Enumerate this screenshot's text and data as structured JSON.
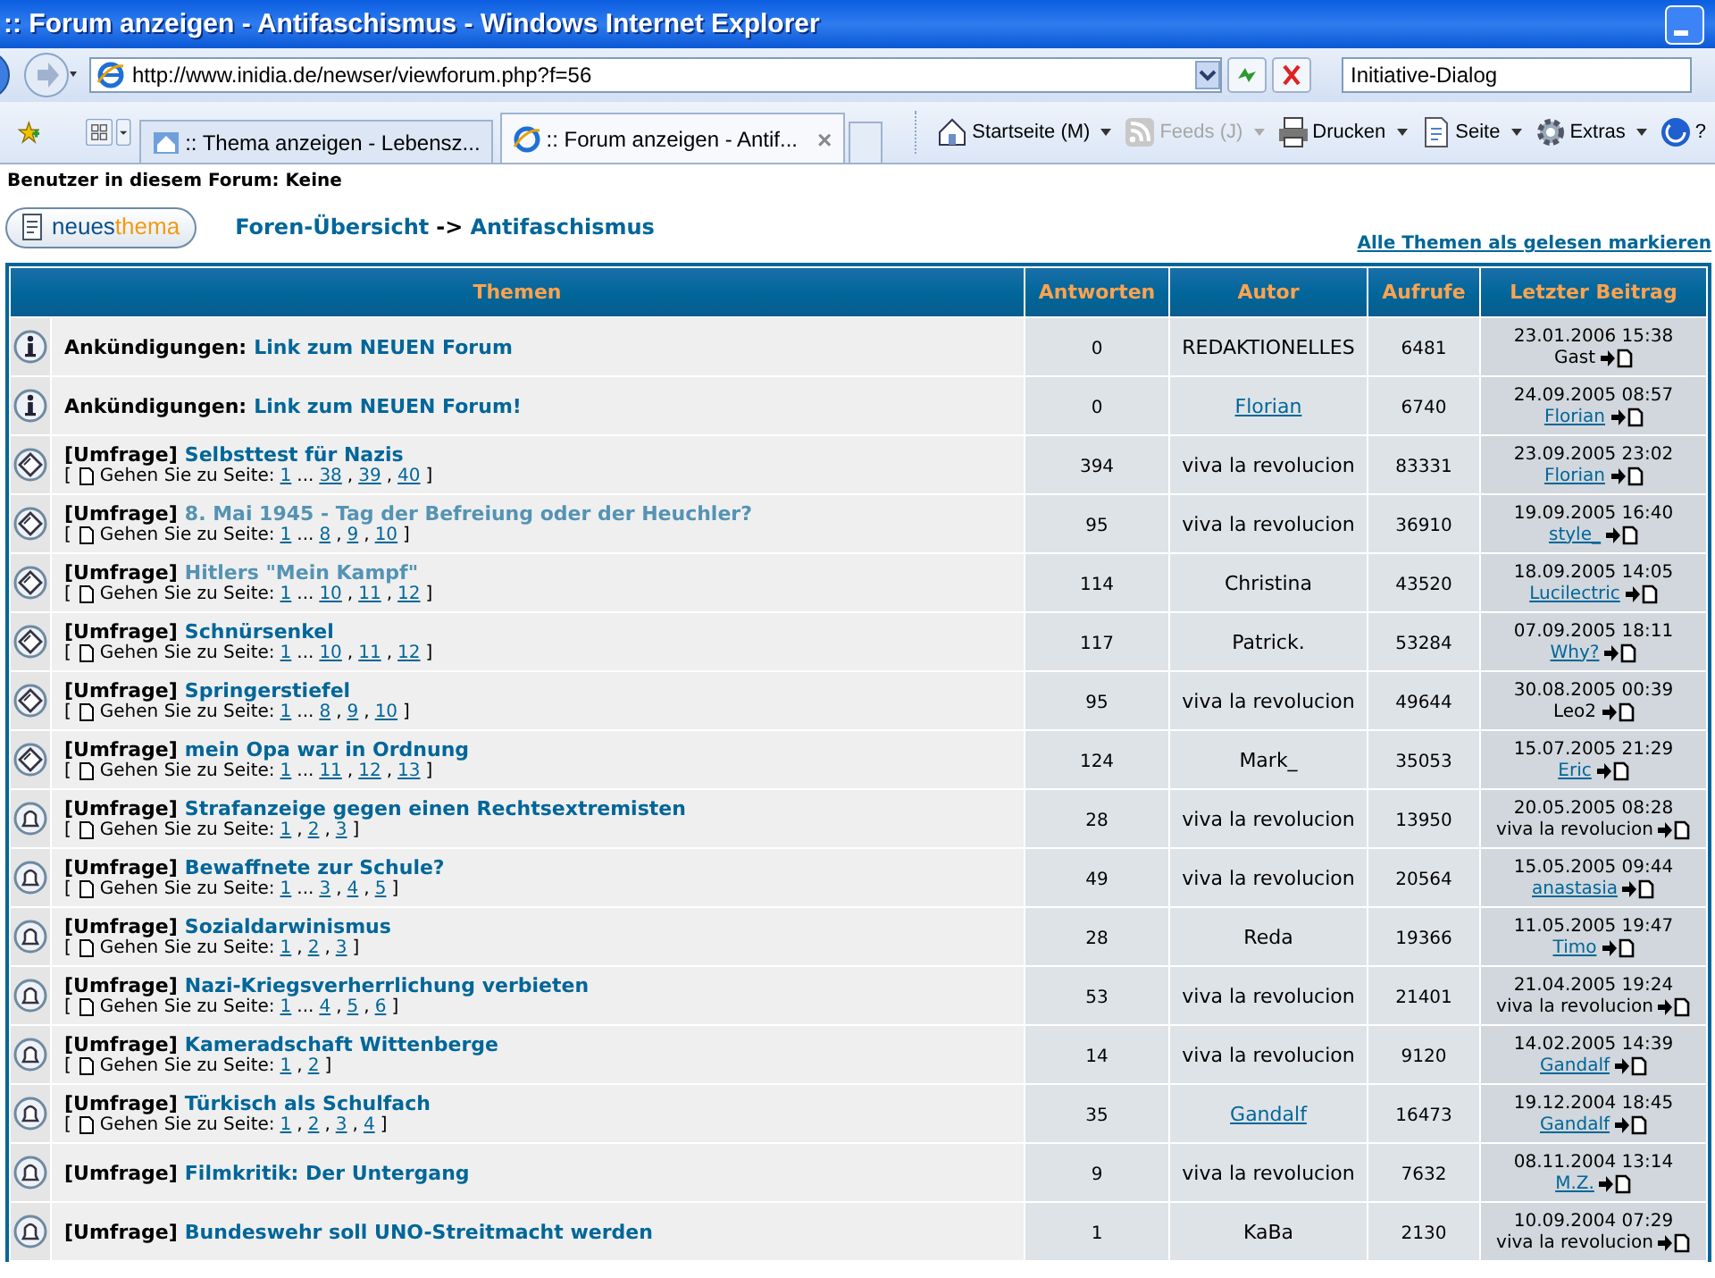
{
  "window": {
    "title": ":: Forum anzeigen - Antifaschismus - Windows Internet Explorer"
  },
  "address_bar": {
    "url": "http://www.inidia.de/newser/viewforum.php?f=56",
    "search": "Initiative-Dialog"
  },
  "tabs": [
    {
      "label": ":: Thema anzeigen - Lebensz...",
      "selected": false
    },
    {
      "label": ":: Forum anzeigen - Antif...",
      "selected": true,
      "close": "×"
    }
  ],
  "command_bar": [
    {
      "kind": "home",
      "label": "Startseite (M)",
      "disabled": false
    },
    {
      "kind": "feeds",
      "label": "Feeds (J)",
      "disabled": true
    },
    {
      "kind": "print",
      "label": "Drucken",
      "disabled": false
    },
    {
      "kind": "page",
      "label": "Seite",
      "disabled": false
    },
    {
      "kind": "tools",
      "label": "Extras",
      "disabled": false
    },
    {
      "kind": "help",
      "label": "?",
      "disabled": false
    }
  ],
  "forum": {
    "users_online": "Benutzer in diesem Forum: Keine",
    "new_topic": {
      "word1": "neues",
      "word2": "thema"
    },
    "breadcrumb": {
      "home": "Foren-Übersicht",
      "separator": "->",
      "current": "Antifaschismus"
    },
    "mark_read": "Alle Themen als gelesen markieren",
    "columns": [
      "Themen",
      "Antworten",
      "Autor",
      "Aufrufe",
      "Letzter Beitrag"
    ],
    "topics": [
      {
        "kind": "announce",
        "prefix": "Ankündigungen:",
        "title": "Link zum NEUEN Forum",
        "visited": false,
        "replies": "0",
        "author": "REDAKTIONELLES",
        "author_link": false,
        "views": "6481",
        "last_date": "23.01.2006 15:38",
        "last_user": "Gast",
        "last_user_link": false
      },
      {
        "kind": "announce",
        "prefix": "Ankündigungen:",
        "title": "Link zum NEUEN Forum!",
        "visited": false,
        "replies": "0",
        "author": "Florian",
        "author_link": true,
        "views": "6740",
        "last_date": "24.09.2005 08:57",
        "last_user": "Florian",
        "last_user_link": true
      },
      {
        "kind": "hot",
        "prefix": "[Umfrage]",
        "title": "Selbsttest für Nazis",
        "visited": false,
        "pager": {
          "open": "[",
          "label": "Gehen Sie zu Seite:",
          "pages": [
            {
              "text": "1",
              "after": "..."
            },
            {
              "text": "38",
              "after": ","
            },
            {
              "text": "39",
              "after": ","
            },
            {
              "text": "40"
            }
          ],
          "close": "]"
        },
        "replies": "394",
        "author": "viva la revolucion",
        "author_link": false,
        "views": "83331",
        "last_date": "23.09.2005 23:02",
        "last_user": "Florian",
        "last_user_link": true
      },
      {
        "kind": "hot",
        "prefix": "[Umfrage]",
        "title": "8. Mai 1945 - Tag der Befreiung oder der Heuchler?",
        "visited": true,
        "pager": {
          "open": "[",
          "label": "Gehen Sie zu Seite:",
          "pages": [
            {
              "text": "1",
              "after": "..."
            },
            {
              "text": "8",
              "after": ","
            },
            {
              "text": "9",
              "after": ","
            },
            {
              "text": "10"
            }
          ],
          "close": "]"
        },
        "replies": "95",
        "author": "viva la revolucion",
        "author_link": false,
        "views": "36910",
        "last_date": "19.09.2005 16:40",
        "last_user": "style_",
        "last_user_link": true
      },
      {
        "kind": "hot",
        "prefix": "[Umfrage]",
        "title": "Hitlers \"Mein Kampf\"",
        "visited": true,
        "pager": {
          "open": "[",
          "label": "Gehen Sie zu Seite:",
          "pages": [
            {
              "text": "1",
              "after": "..."
            },
            {
              "text": "10",
              "after": ","
            },
            {
              "text": "11",
              "after": ","
            },
            {
              "text": "12"
            }
          ],
          "close": "]"
        },
        "replies": "114",
        "author": "Christina",
        "author_link": false,
        "views": "43520",
        "last_date": "18.09.2005 14:05",
        "last_user": "Lucilectric",
        "last_user_link": true
      },
      {
        "kind": "hot",
        "prefix": "[Umfrage]",
        "title": "Schnürsenkel",
        "visited": false,
        "pager": {
          "open": "[",
          "label": "Gehen Sie zu Seite:",
          "pages": [
            {
              "text": "1",
              "after": "..."
            },
            {
              "text": "10",
              "after": ","
            },
            {
              "text": "11",
              "after": ","
            },
            {
              "text": "12"
            }
          ],
          "close": "]"
        },
        "replies": "117",
        "author": "Patrick.",
        "author_link": false,
        "views": "53284",
        "last_date": "07.09.2005 18:11",
        "last_user": "Why?",
        "last_user_link": true
      },
      {
        "kind": "hot",
        "prefix": "[Umfrage]",
        "title": "Springerstiefel",
        "visited": false,
        "pager": {
          "open": "[",
          "label": "Gehen Sie zu Seite:",
          "pages": [
            {
              "text": "1",
              "after": "..."
            },
            {
              "text": "8",
              "after": ","
            },
            {
              "text": "9",
              "after": ","
            },
            {
              "text": "10"
            }
          ],
          "close": "]"
        },
        "replies": "95",
        "author": "viva la revolucion",
        "author_link": false,
        "views": "49644",
        "last_date": "30.08.2005 00:39",
        "last_user": "Leo2",
        "last_user_link": false
      },
      {
        "kind": "hot",
        "prefix": "[Umfrage]",
        "title": "mein Opa war in Ordnung",
        "visited": false,
        "pager": {
          "open": "[",
          "label": "Gehen Sie zu Seite:",
          "pages": [
            {
              "text": "1",
              "after": "..."
            },
            {
              "text": "11",
              "after": ","
            },
            {
              "text": "12",
              "after": ","
            },
            {
              "text": "13"
            }
          ],
          "close": "]"
        },
        "replies": "124",
        "author": "Mark_",
        "author_link": false,
        "views": "35053",
        "last_date": "15.07.2005 21:29",
        "last_user": "Eric",
        "last_user_link": true
      },
      {
        "kind": "poll",
        "prefix": "[Umfrage]",
        "title": "Strafanzeige gegen einen Rechtsextremisten",
        "visited": false,
        "pager": {
          "open": "[",
          "label": "Gehen Sie zu Seite:",
          "pages": [
            {
              "text": "1",
              "after": ","
            },
            {
              "text": "2",
              "after": ","
            },
            {
              "text": "3"
            }
          ],
          "close": "]"
        },
        "replies": "28",
        "author": "viva la revolucion",
        "author_link": false,
        "views": "13950",
        "last_date": "20.05.2005 08:28",
        "last_user": "viva la revolucion",
        "last_user_link": false
      },
      {
        "kind": "poll",
        "prefix": "[Umfrage]",
        "title": "Bewaffnete zur Schule?",
        "visited": false,
        "pager": {
          "open": "[",
          "label": "Gehen Sie zu Seite:",
          "pages": [
            {
              "text": "1",
              "after": "..."
            },
            {
              "text": "3",
              "after": ","
            },
            {
              "text": "4",
              "after": ","
            },
            {
              "text": "5"
            }
          ],
          "close": "]"
        },
        "replies": "49",
        "author": "viva la revolucion",
        "author_link": false,
        "views": "20564",
        "last_date": "15.05.2005 09:44",
        "last_user": "anastasia",
        "last_user_link": true
      },
      {
        "kind": "poll",
        "prefix": "[Umfrage]",
        "title": "Sozialdarwinismus",
        "visited": false,
        "pager": {
          "open": "[",
          "label": "Gehen Sie zu Seite:",
          "pages": [
            {
              "text": "1",
              "after": ","
            },
            {
              "text": "2",
              "after": ","
            },
            {
              "text": "3"
            }
          ],
          "close": "]"
        },
        "replies": "28",
        "author": "Reda",
        "author_link": false,
        "views": "19366",
        "last_date": "11.05.2005 19:47",
        "last_user": "Timo",
        "last_user_link": true
      },
      {
        "kind": "poll",
        "prefix": "[Umfrage]",
        "title": "Nazi-Kriegsverherrlichung verbieten",
        "visited": false,
        "pager": {
          "open": "[",
          "label": "Gehen Sie zu Seite:",
          "pages": [
            {
              "text": "1",
              "after": "..."
            },
            {
              "text": "4",
              "after": ","
            },
            {
              "text": "5",
              "after": ","
            },
            {
              "text": "6"
            }
          ],
          "close": "]"
        },
        "replies": "53",
        "author": "viva la revolucion",
        "author_link": false,
        "views": "21401",
        "last_date": "21.04.2005 19:24",
        "last_user": "viva la revolucion",
        "last_user_link": false
      },
      {
        "kind": "poll",
        "prefix": "[Umfrage]",
        "title": "Kameradschaft Wittenberge",
        "visited": false,
        "pager": {
          "open": "[",
          "label": "Gehen Sie zu Seite:",
          "pages": [
            {
              "text": "1",
              "after": ","
            },
            {
              "text": "2"
            }
          ],
          "close": "]"
        },
        "replies": "14",
        "author": "viva la revolucion",
        "author_link": false,
        "views": "9120",
        "last_date": "14.02.2005 14:39",
        "last_user": "Gandalf",
        "last_user_link": true
      },
      {
        "kind": "poll",
        "prefix": "[Umfrage]",
        "title": "Türkisch als Schulfach",
        "visited": false,
        "pager": {
          "open": "[",
          "label": "Gehen Sie zu Seite:",
          "pages": [
            {
              "text": "1",
              "after": ","
            },
            {
              "text": "2",
              "after": ","
            },
            {
              "text": "3",
              "after": ","
            },
            {
              "text": "4"
            }
          ],
          "close": "]"
        },
        "replies": "35",
        "author": "Gandalf",
        "author_link": true,
        "views": "16473",
        "last_date": "19.12.2004 18:45",
        "last_user": "Gandalf",
        "last_user_link": true
      },
      {
        "kind": "poll",
        "prefix": "[Umfrage]",
        "title": "Filmkritik: Der Untergang",
        "visited": false,
        "replies": "9",
        "author": "viva la revolucion",
        "author_link": false,
        "views": "7632",
        "last_date": "08.11.2004 13:14",
        "last_user": "M.Z.",
        "last_user_link": true
      },
      {
        "kind": "poll",
        "prefix": "[Umfrage]",
        "title": "Bundeswehr soll UNO-Streitmacht werden",
        "visited": false,
        "replies": "1",
        "author": "KaBa",
        "author_link": false,
        "views": "2130",
        "last_date": "10.09.2004 07:29",
        "last_user": "viva la revolucion",
        "last_user_link": false
      }
    ]
  }
}
